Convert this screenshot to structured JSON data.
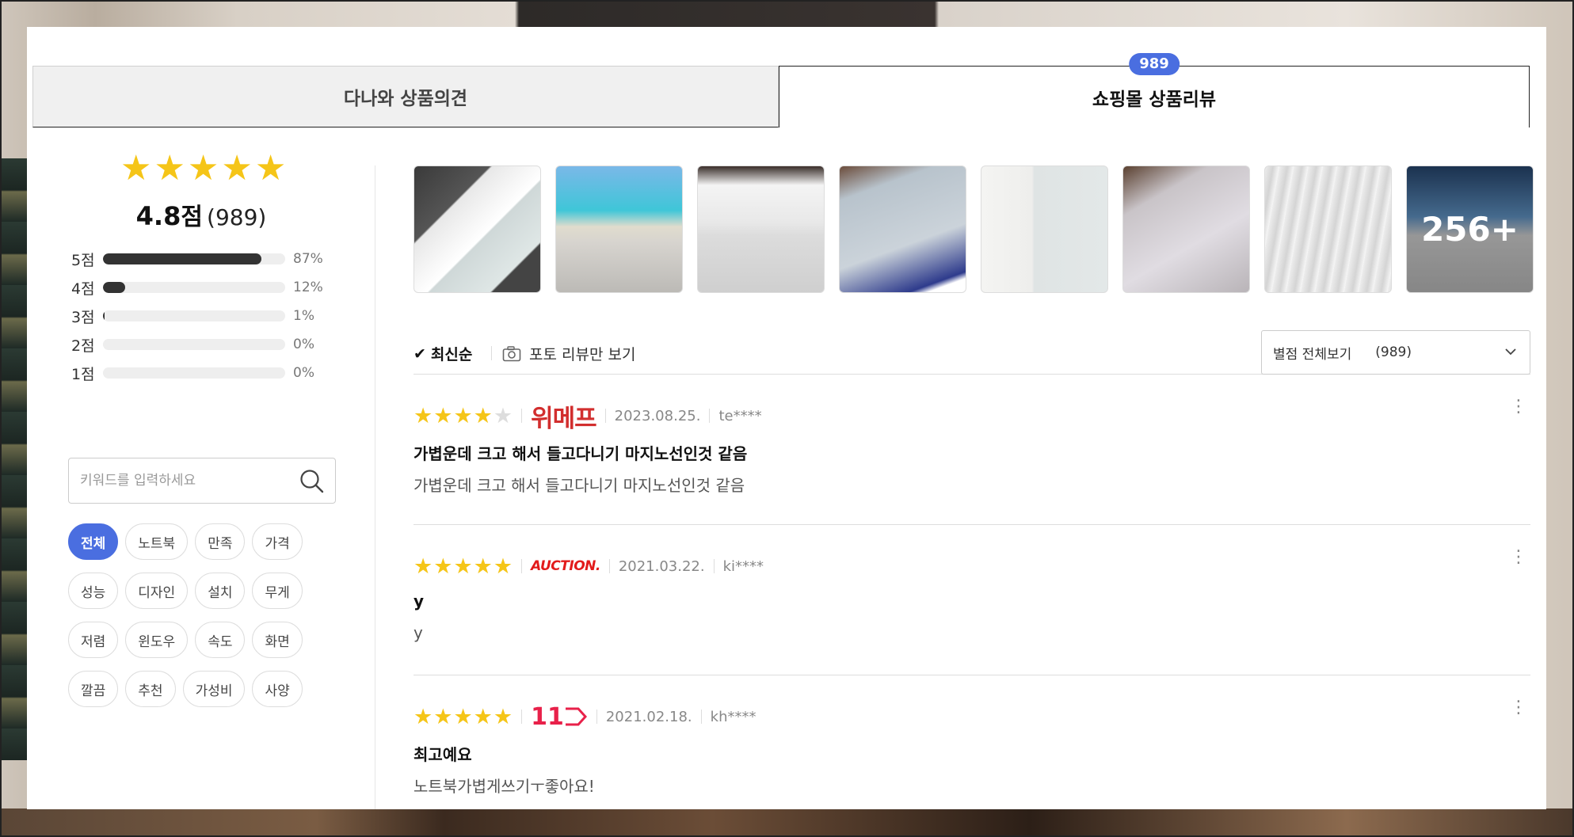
{
  "tabs": {
    "left_label": "다나와 상품의견",
    "right_label": "쇼핑몰 상품리뷰",
    "right_badge": "989"
  },
  "summary": {
    "score": "4.8",
    "score_unit": "점",
    "count": "(989)",
    "stars_filled": 5,
    "distribution": [
      {
        "label": "5점",
        "pct_text": "87%",
        "pct": 87
      },
      {
        "label": "4점",
        "pct_text": "12%",
        "pct": 12
      },
      {
        "label": "3점",
        "pct_text": "1%",
        "pct": 1
      },
      {
        "label": "2점",
        "pct_text": "0%",
        "pct": 0
      },
      {
        "label": "1점",
        "pct_text": "0%",
        "pct": 0
      }
    ]
  },
  "search": {
    "placeholder": "키워드를 입력하세요"
  },
  "keywords": [
    "전체",
    "노트북",
    "만족",
    "가격",
    "성능",
    "디자인",
    "설치",
    "무게",
    "저렴",
    "윈도우",
    "속도",
    "화면",
    "깔끔",
    "추천",
    "가성비",
    "사양"
  ],
  "photos": {
    "more_label": "256+"
  },
  "sort": {
    "newest": "최신순",
    "photo_only": "포토 리뷰만 보기",
    "filter_label": "별점 전체보기",
    "filter_count": "(989)"
  },
  "reviews": [
    {
      "rating": 4,
      "mall": "위메프",
      "mall_color": "#d22e2e",
      "date": "2023.08.25.",
      "user": "te****",
      "title": "가볍운데 크고 해서 들고다니기 마지노선인것 같음",
      "body": "가볍운데 크고 해서 들고다니기 마지노선인것 같음"
    },
    {
      "rating": 5,
      "mall": "AUCTION.",
      "mall_color": "#e21b1b",
      "date": "2021.03.22.",
      "user": "ki****",
      "title": "y",
      "body": "y"
    },
    {
      "rating": 5,
      "mall": "11",
      "mall_color": "#e8214a",
      "date": "2021.02.18.",
      "user": "kh****",
      "title": "최고예요",
      "body": "노트북가볍게쓰기ㅜ좋아요!"
    }
  ]
}
